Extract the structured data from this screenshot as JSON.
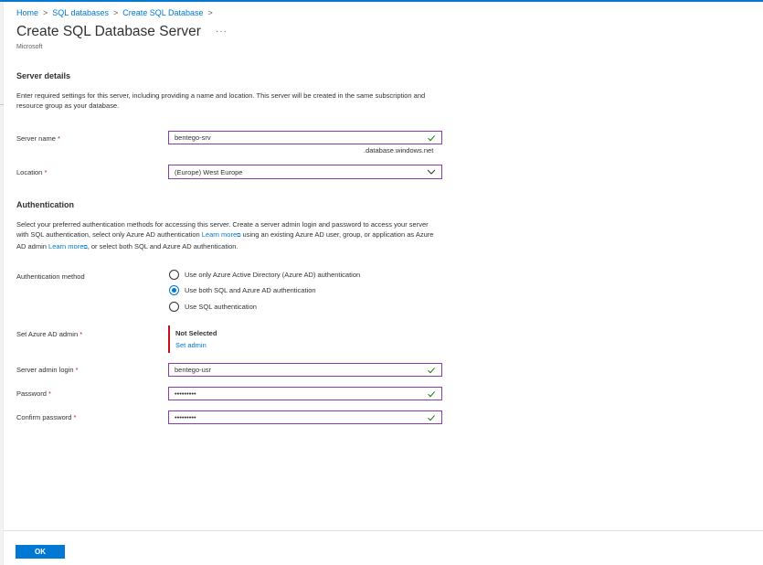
{
  "breadcrumb": {
    "home": "Home",
    "sql_databases": "SQL databases",
    "create_sql_database": "Create SQL Database",
    "separator": ">"
  },
  "header": {
    "title": "Create SQL Database Server",
    "more": "···",
    "publisher": "Microsoft"
  },
  "server_details": {
    "title": "Server details",
    "description": "Enter required settings for this server, including providing a name and location. This server will be created in the same subscription and resource group as your database.",
    "server_name": {
      "label": "Server name",
      "required": "*",
      "value": "bentego-srv",
      "suffix": ".database.windows.net"
    },
    "location": {
      "label": "Location",
      "required": "*",
      "value": "(Europe) West Europe"
    }
  },
  "authentication": {
    "title": "Authentication",
    "description_1": "Select your preferred authentication methods for accessing this server. Create a server admin login and password to access your server with SQL authentication, select only Azure AD authentication",
    "learn_more_1": "Learn more",
    "description_2": "using an existing Azure AD user, group, or application as Azure AD admin",
    "learn_more_2": "Learn more",
    "description_3": ", or select both SQL and Azure AD authentication.",
    "method": {
      "label": "Authentication method",
      "options": [
        {
          "label": "Use only Azure Active Directory (Azure AD) authentication",
          "selected": false
        },
        {
          "label": "Use both SQL and Azure AD authentication",
          "selected": true
        },
        {
          "label": "Use SQL authentication",
          "selected": false
        }
      ]
    },
    "azure_ad_admin": {
      "label": "Set Azure AD admin",
      "required": "*",
      "status": "Not Selected",
      "link": "Set admin"
    },
    "admin_login": {
      "label": "Server admin login",
      "required": "*",
      "value": "bentego-usr"
    },
    "password": {
      "label": "Password",
      "required": "*",
      "value": "•••••••••"
    },
    "confirm_password": {
      "label": "Confirm password",
      "required": "*",
      "value": "•••••••••"
    }
  },
  "footer": {
    "ok_label": "OK"
  },
  "icons": {
    "valid": "checkmark-icon",
    "dropdown": "chevron-down-icon",
    "external": "external-link-icon"
  },
  "colors": {
    "accent": "#0078d4",
    "field_border": "#8a3ab0",
    "required": "#a4262c",
    "error_bar": "#c50f1f",
    "valid": "#107c10"
  }
}
